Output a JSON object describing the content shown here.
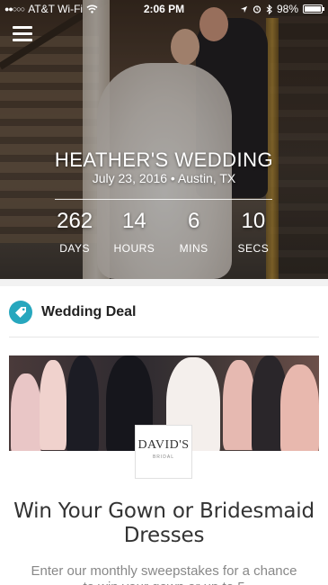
{
  "status_bar": {
    "carrier": "AT&T Wi-Fi",
    "time": "2:06 PM",
    "battery": "98%"
  },
  "hero": {
    "title": "HEATHER'S WEDDING",
    "subtitle": "July 23, 2016 • Austin, TX",
    "countdown": [
      {
        "value": "262",
        "label": "DAYS"
      },
      {
        "value": "14",
        "label": "HOURS"
      },
      {
        "value": "6",
        "label": "MINS"
      },
      {
        "value": "10",
        "label": "SECS"
      }
    ]
  },
  "deal": {
    "section_title": "Wedding Deal",
    "brand": "DAVID'S",
    "brand_sub": "BRIDAL",
    "headline": "Win Your Gown or Bridesmaid Dresses",
    "body": "Enter our monthly sweepstakes for a chance to win your gown or up to 5"
  },
  "colors": {
    "accent": "#27a7be"
  }
}
